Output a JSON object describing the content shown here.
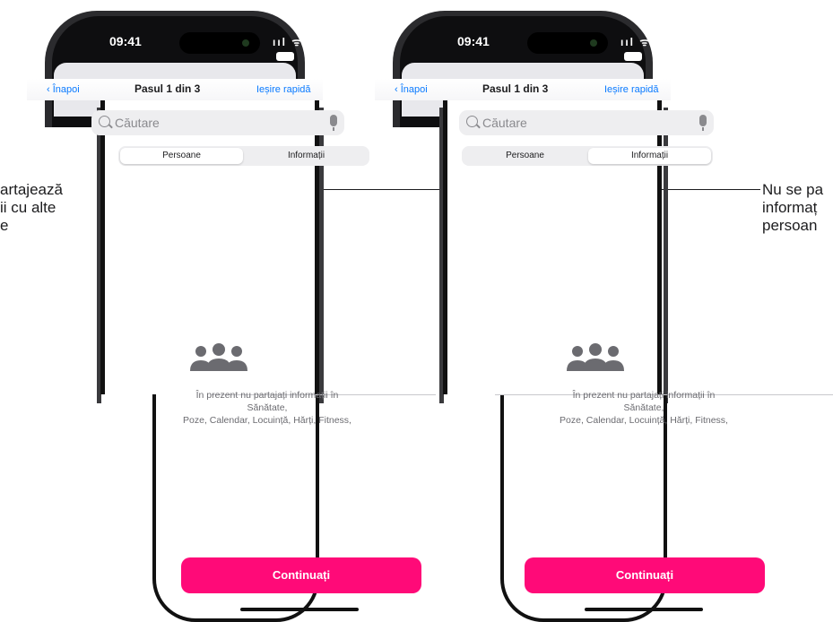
{
  "captions": {
    "left": "artajează\nii cu alte\ne",
    "right": "Nu se pa\ninformaț\npersoan"
  },
  "phones": [
    {
      "status": {
        "time": "09:41",
        "signal": "ııl ᯤ"
      },
      "nav": {
        "back": "‹ Înapoi",
        "title": "Pasul 1 din 3",
        "action": "Ieșire rapidă"
      },
      "search": {
        "placeholder": "Căutare"
      },
      "segments": {
        "first": "Persoane",
        "second": "Informații",
        "active": "first"
      },
      "info_text": "În prezent nu partajați informații în\nSănătate,\nPoze, Calendar, Locuință, Hărți, Fitness,",
      "continue_label": "Continuați"
    },
    {
      "status": {
        "time": "09:41",
        "signal": "ııl ᯤ"
      },
      "nav": {
        "back": "‹ Înapoi",
        "title": "Pasul 1 din 3",
        "action": "Ieșire rapidă"
      },
      "search": {
        "placeholder": "Căutare"
      },
      "segments": {
        "first": "Persoane",
        "second": "Informații",
        "active": "second"
      },
      "info_text": "În prezent nu partajați informații în\nSănătate,\nPoze, Calendar, Locuință, Hărți, Fitness,",
      "continue_label": "Continuați"
    }
  ],
  "colors": {
    "accent": "#ff0a78",
    "link": "#0a7aff",
    "icon": "#6b6b70"
  }
}
